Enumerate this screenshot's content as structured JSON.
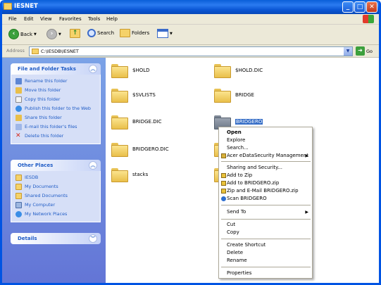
{
  "window": {
    "title": "IESNET"
  },
  "menu": [
    "File",
    "Edit",
    "View",
    "Favorites",
    "Tools",
    "Help"
  ],
  "toolbar": {
    "back": "Back",
    "search": "Search",
    "folders": "Folders"
  },
  "address": {
    "label": "Address",
    "path": "C:\\IESDB\\IESNET",
    "go": "Go"
  },
  "tasks": {
    "title": "File and Folder Tasks",
    "items": [
      "Rename this folder",
      "Move this folder",
      "Copy this folder",
      "Publish this folder to the Web",
      "Share this folder",
      "E-mail this folder's files",
      "Delete this folder"
    ]
  },
  "other_places": {
    "title": "Other Places",
    "items": [
      "IESDB",
      "My Documents",
      "Shared Documents",
      "My Computer",
      "My Network Places"
    ]
  },
  "details": {
    "title": "Details"
  },
  "folders": [
    "$HOLD",
    "$HOLD.DIC",
    "$SVLISTS",
    "BRIDGE",
    "BRIDGE.DIC",
    "BRIDGERO",
    "BRIDGERO.DIC",
    "stacks"
  ],
  "context_menu": {
    "items": [
      "Open",
      "Explore",
      "Search...",
      "Acer eDataSecurity Management",
      "Sharing and Security...",
      "Add to Zip",
      "Add to BRIDGERO.zip",
      "Zip and E-Mail BRIDGERO.zip",
      "Scan BRIDGERO",
      "Send To",
      "Cut",
      "Copy",
      "Create Shortcut",
      "Delete",
      "Rename",
      "Properties"
    ]
  },
  "colors": {
    "title_bar": "#0a56d4",
    "task_pane": "#6375d6",
    "selection": "#316ac5",
    "link": "#215dc6"
  }
}
